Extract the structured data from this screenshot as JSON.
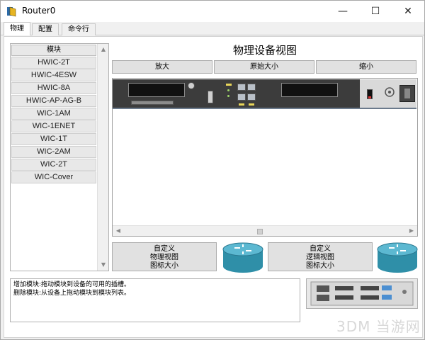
{
  "window": {
    "title": "Router0",
    "minimize_glyph": "—",
    "maximize_glyph": "☐",
    "close_glyph": "✕"
  },
  "tabs": [
    {
      "label": "物理",
      "active": true
    },
    {
      "label": "配置",
      "active": false
    },
    {
      "label": "命令行",
      "active": false
    }
  ],
  "modules": {
    "header": "模块",
    "items": [
      "HWIC-2T",
      "HWIC-4ESW",
      "HWIC-8A",
      "HWIC-AP-AG-B",
      "WIC-1AM",
      "WIC-1ENET",
      "WIC-1T",
      "WIC-2AM",
      "WIC-2T",
      "WIC-Cover"
    ]
  },
  "physical_view": {
    "title": "物理设备视图",
    "zoom_in": "放大",
    "original_size": "原始大小",
    "zoom_out": "缩小"
  },
  "customize": {
    "physical_icon_label_1": "自定义",
    "physical_icon_label_2": "物理视图",
    "physical_icon_label_3": "图标大小",
    "logical_icon_label_1": "自定义",
    "logical_icon_label_2": "逻辑视图",
    "logical_icon_label_3": "图标大小"
  },
  "info": {
    "line1": "增加模块:拖动模块到设备的可用的插槽。",
    "line2": "删除模块:从设备上拖动模块到模块列表。"
  },
  "watermark": "3DM 当游网",
  "colors": {
    "router_body": "#3c3c3c",
    "router_icon": "#2f8fa8"
  }
}
